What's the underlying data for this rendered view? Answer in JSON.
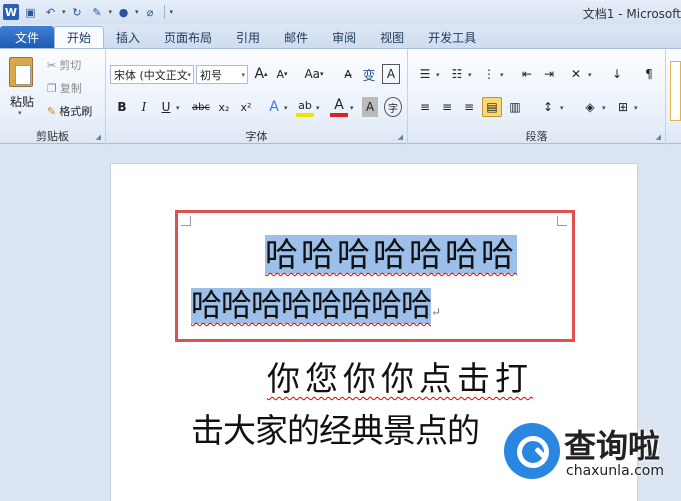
{
  "window": {
    "title": "文档1 - Microsoft"
  },
  "qat": {
    "logo": "W"
  },
  "tabs": {
    "file": "文件",
    "home": "开始",
    "insert": "插入",
    "layout": "页面布局",
    "references": "引用",
    "mailings": "邮件",
    "review": "审阅",
    "view": "视图",
    "developer": "开发工具"
  },
  "clipboard": {
    "paste": "粘贴",
    "cut": "剪切",
    "copy": "复制",
    "format_painter": "格式刷",
    "group_label": "剪贴板"
  },
  "font": {
    "name": "宋体 (中文正文",
    "size": "初号",
    "grow": "A",
    "shrink": "A",
    "change_case": "Aa",
    "bold": "B",
    "italic": "I",
    "underline": "U",
    "strike": "abc",
    "subscript": "x₂",
    "superscript": "x²",
    "text_effect": "A",
    "font_color": "A",
    "char_shading": "A",
    "enclose": "字",
    "group_label": "字体"
  },
  "paragraph": {
    "group_label": "段落"
  },
  "document": {
    "line1": "哈哈哈哈哈哈哈",
    "line2": "哈哈哈哈哈哈哈哈",
    "line3": "你您你你点击打",
    "line4": "击大家的经典景点的"
  },
  "watermark": {
    "title": "查询啦",
    "url": "chaxunla.com"
  },
  "colors": {
    "file_tab": "#2b68c4",
    "highlight": "#9cc0e9",
    "selection_box": "#e15050",
    "font_color_bar": "#e02020",
    "highlight_bar": "#f5e400"
  }
}
